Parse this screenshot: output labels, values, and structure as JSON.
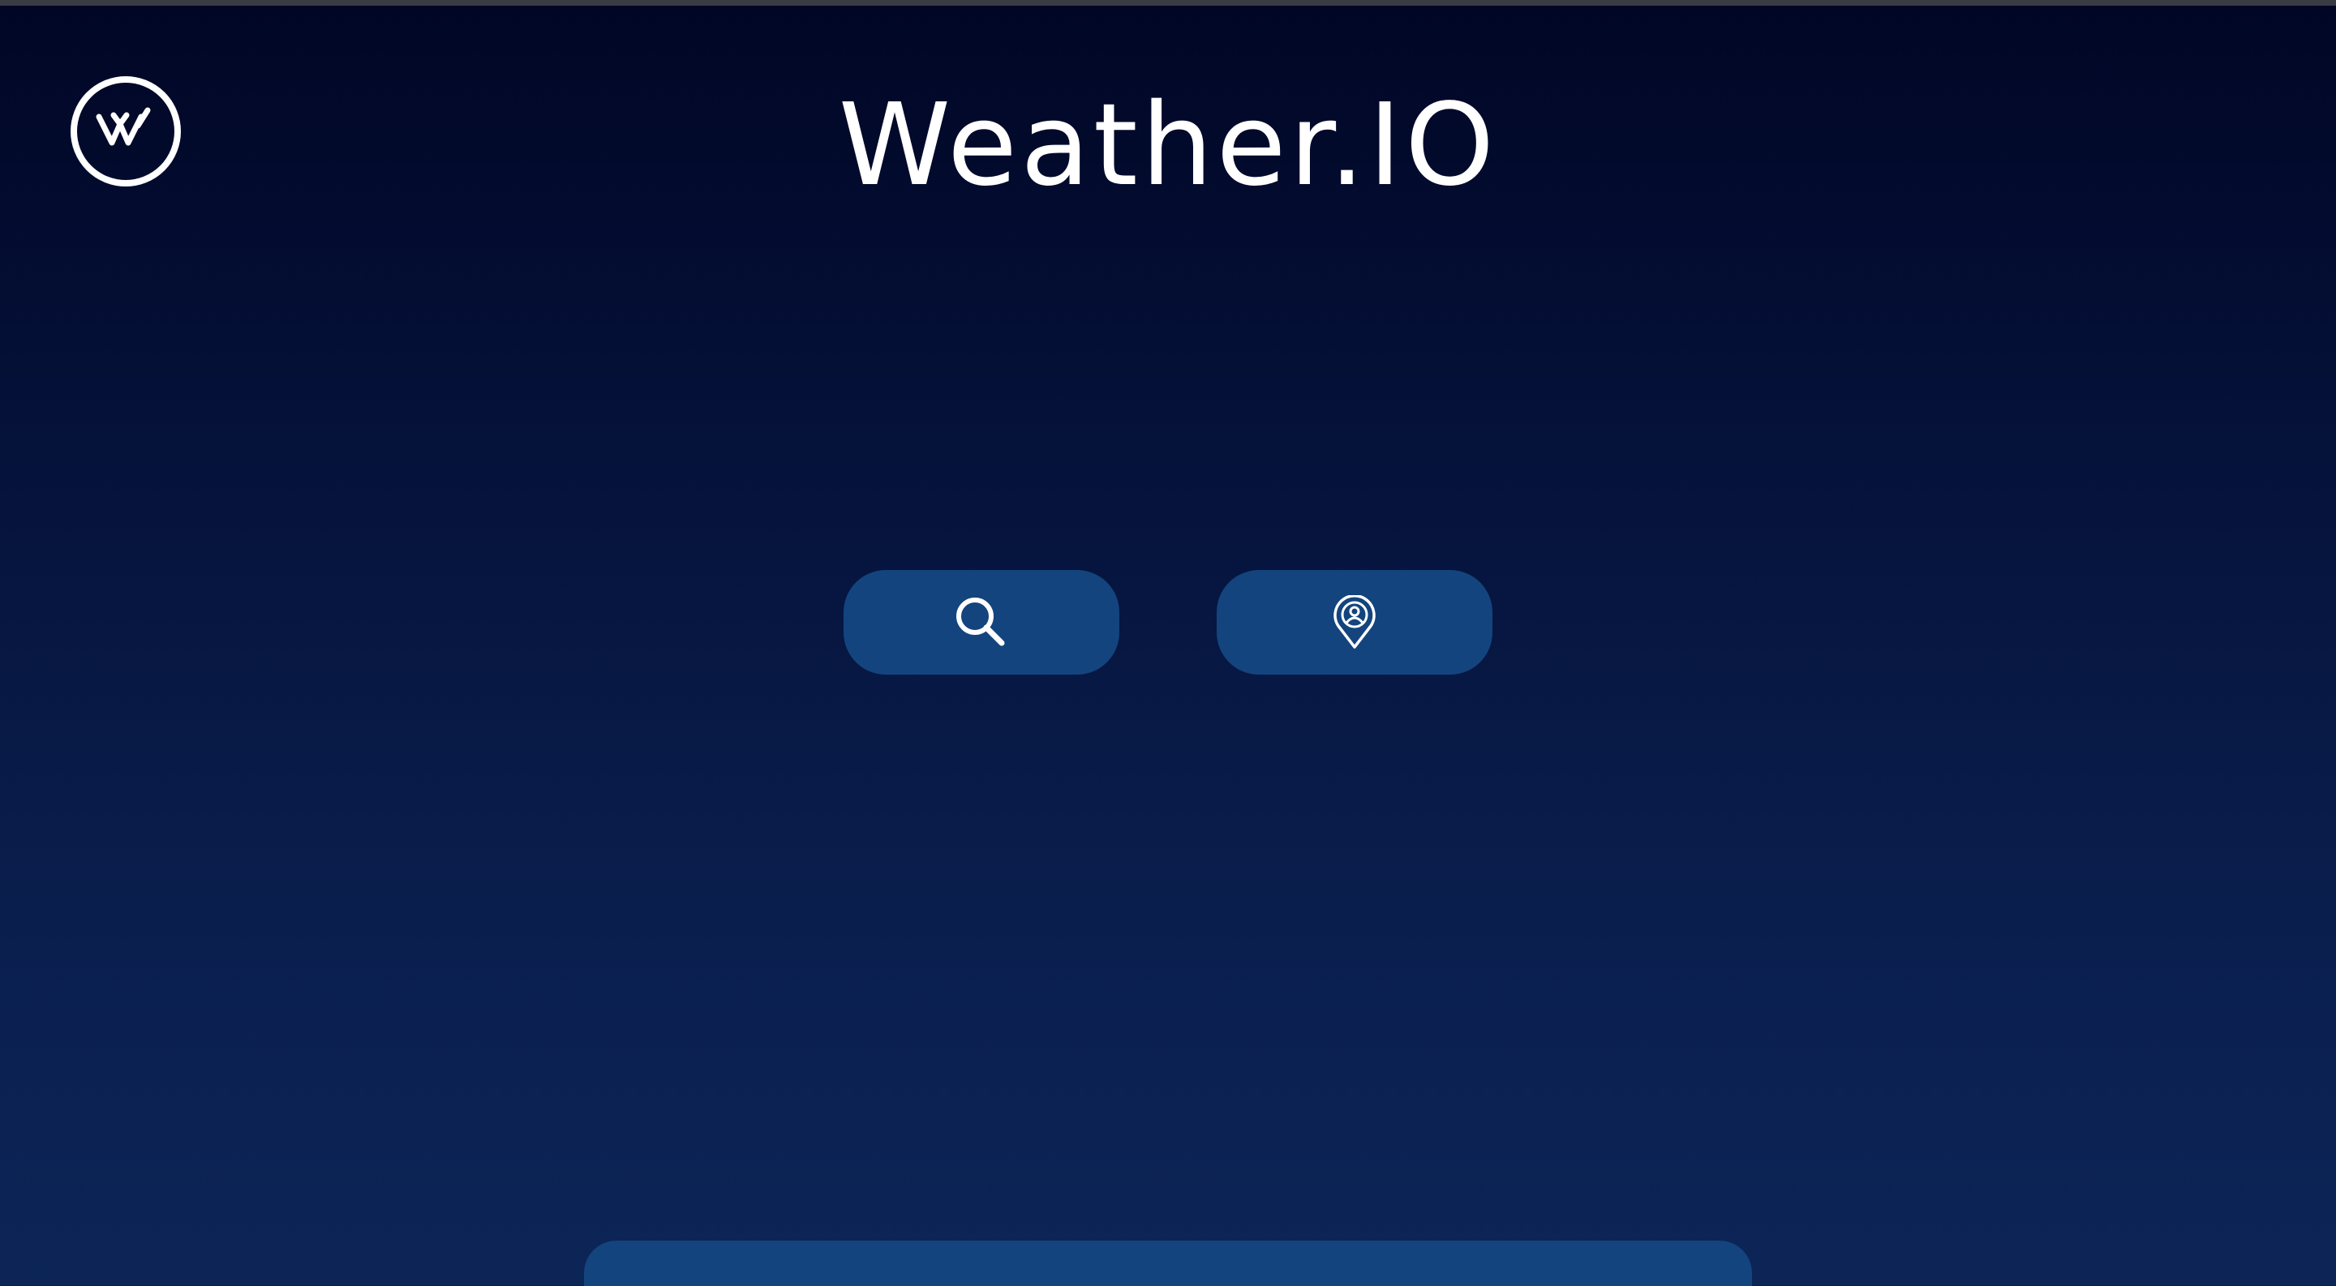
{
  "app": {
    "title": "Weather.IO",
    "logo_letter": "W"
  },
  "actions": {
    "search_icon": "search-icon",
    "location_icon": "user-location-pin-icon"
  },
  "colors": {
    "background_top": "#010625",
    "background_bottom": "#0c2557",
    "button": "#13447e",
    "foreground": "#ffffff"
  }
}
